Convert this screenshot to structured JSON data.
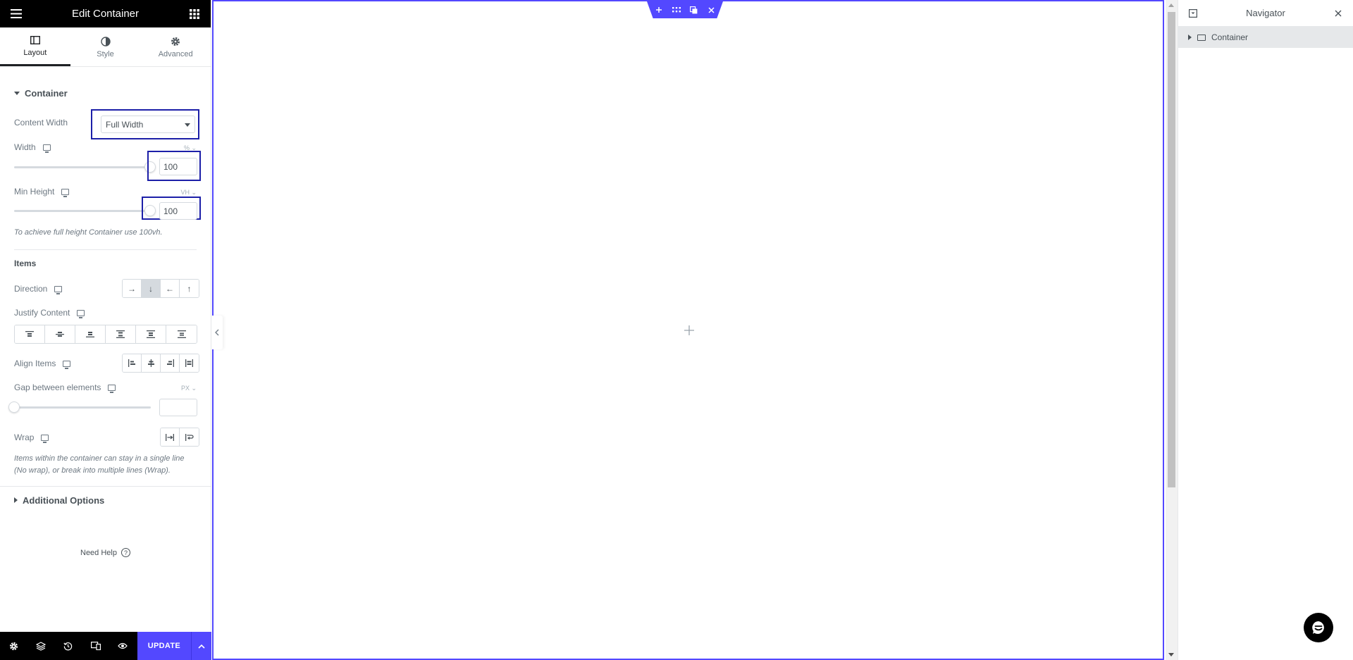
{
  "panel": {
    "title": "Edit Container",
    "tabs": [
      {
        "label": "Layout",
        "icon": "layout-icon"
      },
      {
        "label": "Style",
        "icon": "half-circle-icon"
      },
      {
        "label": "Advanced",
        "icon": "gear-icon"
      }
    ],
    "active_tab": "Layout"
  },
  "container_section": {
    "title": "Container",
    "content_width": {
      "label": "Content Width",
      "value": "Full Width"
    },
    "width": {
      "label": "Width",
      "unit": "%",
      "value": "100",
      "slider_fraction": 1.0
    },
    "min_height": {
      "label": "Min Height",
      "unit": "VH",
      "value": "100",
      "slider_fraction": 1.0
    },
    "note": "To achieve full height Container use 100vh."
  },
  "items_section": {
    "title": "Items",
    "direction": {
      "label": "Direction",
      "selected": 1,
      "options": [
        "→",
        "↓",
        "←",
        "↑"
      ]
    },
    "justify_content": {
      "label": "Justify Content",
      "options": [
        "justify-start-icon",
        "justify-center-icon",
        "justify-end-icon",
        "space-between-icon",
        "space-around-icon",
        "space-evenly-icon"
      ]
    },
    "align_items": {
      "label": "Align Items",
      "options": [
        "align-start-icon",
        "align-center-icon",
        "align-end-icon",
        "align-stretch-icon"
      ]
    },
    "gap": {
      "label": "Gap between elements",
      "unit": "PX",
      "value": "",
      "slider_fraction": 0.0
    },
    "wrap": {
      "label": "Wrap",
      "options": [
        "no-wrap-icon",
        "wrap-icon"
      ]
    },
    "wrap_note": "Items within the container can stay in a single line (No wrap), or break into multiple lines (Wrap)."
  },
  "additional": {
    "title": "Additional Options"
  },
  "help": {
    "label": "Need Help"
  },
  "footer": {
    "icons": [
      "settings-icon",
      "layers-icon",
      "history-icon",
      "responsive-icon",
      "preview-icon"
    ],
    "update_label": "UPDATE"
  },
  "navigator": {
    "title": "Navigator",
    "items": [
      {
        "label": "Container"
      }
    ]
  },
  "colors": {
    "accent": "#5348ff",
    "highlight": "#1c1fa8",
    "header_bg": "#000000"
  }
}
